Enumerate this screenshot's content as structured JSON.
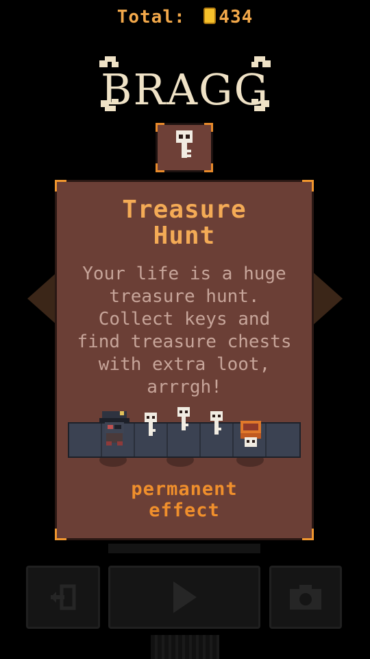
{
  "header": {
    "total_label": "Total:",
    "coin_icon": "gold-coin-icon",
    "total_value": "434"
  },
  "logo": {
    "text": "BRAGG",
    "icon": "crossed-bones-icon"
  },
  "badge": {
    "icon": "skull-key-icon"
  },
  "card": {
    "title_line1": "Treasure",
    "title_line2": "Hunt",
    "description": "Your life is a huge treasure hunt. Collect keys and find treasure chests with extra loot, arrrgh!",
    "effect_line1": "permanent",
    "effect_line2": "effect"
  },
  "controls": {
    "exit_icon": "exit-door-icon",
    "play_icon": "play-icon",
    "camera_icon": "camera-icon"
  },
  "colors": {
    "accent": "#f4ab56",
    "card_bg": "#6b3f36",
    "text": "#c7a59a",
    "coin": "#f6c12b"
  }
}
